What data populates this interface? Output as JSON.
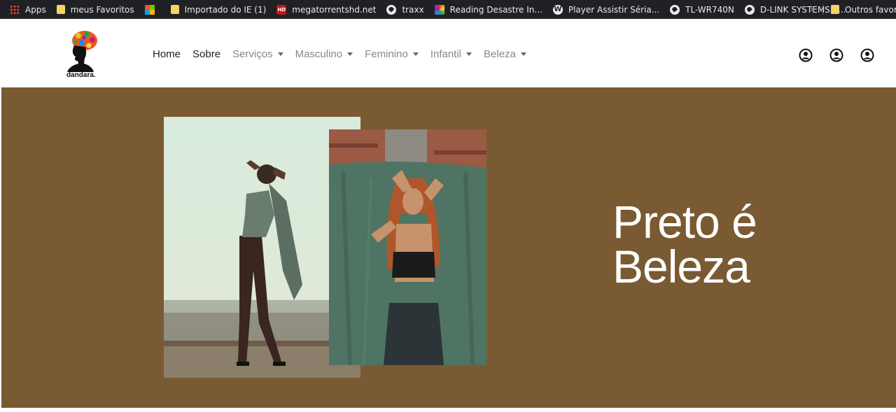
{
  "bookmarks": [
    {
      "label": "Apps",
      "icon": "apps-icon"
    },
    {
      "label": "meus Favoritos",
      "icon": "folder-icon"
    },
    {
      "label": "",
      "icon": "microsoft-icon"
    },
    {
      "label": "Importado do IE (1)",
      "icon": "folder-icon"
    },
    {
      "label": "megatorrentshd.net",
      "icon": "hd-icon"
    },
    {
      "label": "traxx",
      "icon": "globe-icon"
    },
    {
      "label": "Reading Desastre In...",
      "icon": "reading-icon"
    },
    {
      "label": "Player Assistir Séria...",
      "icon": "wordpress-icon"
    },
    {
      "label": "TL-WR740N",
      "icon": "globe-icon"
    },
    {
      "label": "D-LINK SYSTEMS, I...",
      "icon": "globe-icon"
    }
  ],
  "bookmarks_overflow": "»",
  "other_bookmarks": "Outros favoritos",
  "brand": {
    "name": "dandara."
  },
  "nav": [
    {
      "label": "Home",
      "dropdown": false
    },
    {
      "label": "Sobre",
      "dropdown": false
    },
    {
      "label": "Serviços",
      "dropdown": true
    },
    {
      "label": "Masculino",
      "dropdown": true
    },
    {
      "label": "Feminino",
      "dropdown": true
    },
    {
      "label": "Infantil",
      "dropdown": true
    },
    {
      "label": "Beleza",
      "dropdown": true
    }
  ],
  "user_icons": [
    "user-circle-icon",
    "user-circle-icon",
    "user-circle-icon"
  ],
  "hero": {
    "title_line1": "Preto é",
    "title_line2": "Beleza",
    "background": "#7a5a32"
  }
}
